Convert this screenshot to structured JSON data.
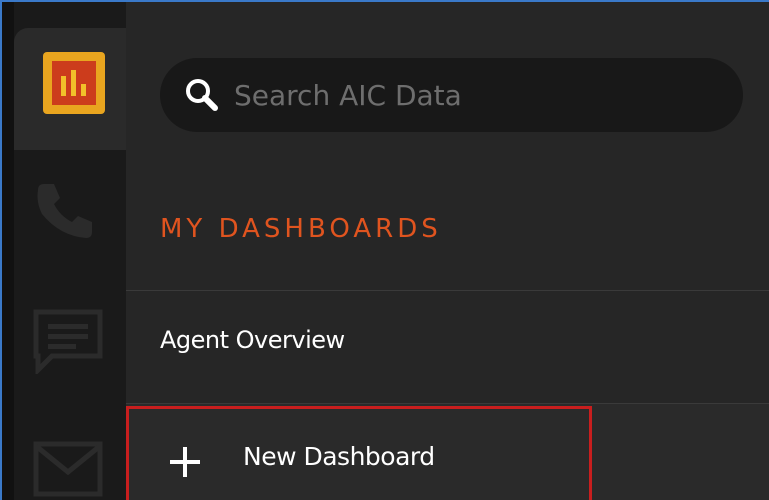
{
  "app": {
    "logo_icon": "bar-chart-logo-icon",
    "accent_color": "#e0541f",
    "logo_color": "#e9a51f"
  },
  "rail": {
    "items": [
      {
        "icon": "phone-icon"
      },
      {
        "icon": "chat-icon"
      },
      {
        "icon": "mail-icon"
      }
    ]
  },
  "search": {
    "icon": "search-icon",
    "placeholder": "Search AIC Data",
    "value": ""
  },
  "dashboards": {
    "section_title": "MY DASHBOARDS",
    "items": [
      {
        "label": "Agent Overview"
      }
    ],
    "new_button": {
      "icon": "plus-icon",
      "label": "New Dashboard",
      "highlight_color": "#c81e1e"
    }
  }
}
